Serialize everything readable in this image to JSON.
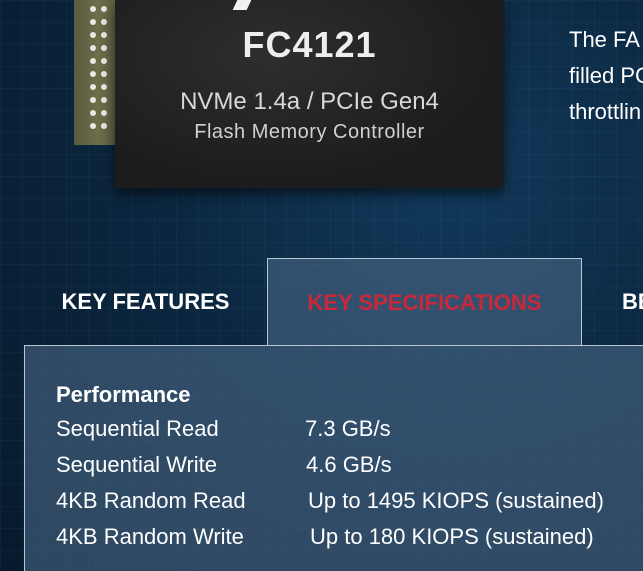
{
  "chip": {
    "model": "FC4121",
    "interface": "NVMe 1.4a / PCIe Gen4",
    "type": "Flash Memory Controller"
  },
  "intro": {
    "lines": [
      "The FA",
      "filled PC",
      "throttlin"
    ]
  },
  "tabs": [
    {
      "label": "KEY FEATURES",
      "active": false
    },
    {
      "label": "KEY SPECIFICATIONS",
      "active": true
    },
    {
      "label": "BE",
      "active": false
    }
  ],
  "specs": {
    "section_title": "Performance",
    "rows": [
      {
        "label": "Sequential Read",
        "value": "7.3 GB/s"
      },
      {
        "label": "Sequential Write",
        "value": "4.6 GB/s"
      },
      {
        "label": "4KB Random Read",
        "value": "Up to 1495 KIOPS (sustained)"
      },
      {
        "label": "4KB Random Write",
        "value": "Up to 180 KIOPS (sustained)"
      }
    ]
  },
  "colors": {
    "active_tab_text": "#c8283a",
    "background": "#0b2740",
    "panel": "#506e8c"
  }
}
